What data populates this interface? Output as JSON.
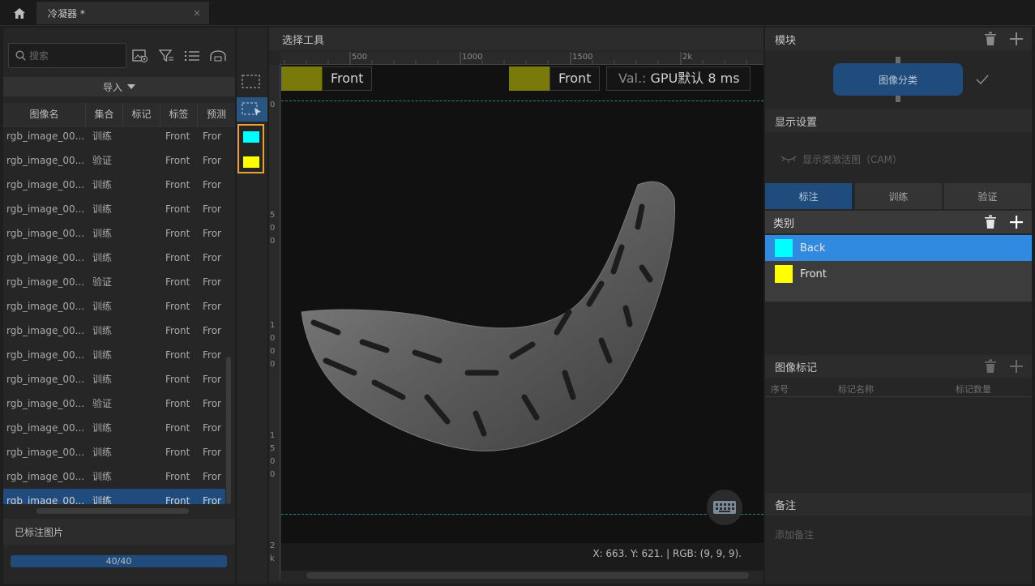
{
  "tab": {
    "title": "冷凝器 *",
    "close": "×"
  },
  "left": {
    "search_placeholder": "搜索",
    "import_label": "导入",
    "columns": [
      "图像名",
      "集合",
      "标记",
      "标签",
      "预测"
    ],
    "rows": [
      {
        "name": "rgb_image_00...",
        "set": "训练",
        "tag": "Front",
        "pred": "Fror"
      },
      {
        "name": "rgb_image_00...",
        "set": "验证",
        "tag": "Front",
        "pred": "Fror"
      },
      {
        "name": "rgb_image_00...",
        "set": "训练",
        "tag": "Front",
        "pred": "Fror"
      },
      {
        "name": "rgb_image_00...",
        "set": "训练",
        "tag": "Front",
        "pred": "Fror"
      },
      {
        "name": "rgb_image_00...",
        "set": "训练",
        "tag": "Front",
        "pred": "Fror"
      },
      {
        "name": "rgb_image_00...",
        "set": "训练",
        "tag": "Front",
        "pred": "Fror"
      },
      {
        "name": "rgb_image_00...",
        "set": "验证",
        "tag": "Front",
        "pred": "Fror"
      },
      {
        "name": "rgb_image_00...",
        "set": "训练",
        "tag": "Front",
        "pred": "Fror"
      },
      {
        "name": "rgb_image_00...",
        "set": "训练",
        "tag": "Front",
        "pred": "Fror"
      },
      {
        "name": "rgb_image_00...",
        "set": "训练",
        "tag": "Front",
        "pred": "Fror"
      },
      {
        "name": "rgb_image_00...",
        "set": "训练",
        "tag": "Front",
        "pred": "Fror"
      },
      {
        "name": "rgb_image_00...",
        "set": "验证",
        "tag": "Front",
        "pred": "Fror"
      },
      {
        "name": "rgb_image_00...",
        "set": "训练",
        "tag": "Front",
        "pred": "Fror"
      },
      {
        "name": "rgb_image_00...",
        "set": "训练",
        "tag": "Front",
        "pred": "Fror"
      },
      {
        "name": "rgb_image_00...",
        "set": "训练",
        "tag": "Front",
        "pred": "Fror"
      },
      {
        "name": "rgb_image_00...",
        "set": "训练",
        "tag": "Front",
        "pred": "Fror"
      }
    ],
    "selected_row": 15,
    "labeled_title": "已标注图片",
    "progress_text": "40/40",
    "progress_value": 1.0
  },
  "tools": {
    "swatch_colors": [
      "#00ffff",
      "#ffff00"
    ]
  },
  "canvas": {
    "title": "选择工具",
    "ruler_top": [
      "500",
      "1000",
      "1500",
      "2k"
    ],
    "ruler_left": [
      "0",
      "5",
      "0",
      "0",
      "1",
      "0",
      "0",
      "0",
      "1",
      "5",
      "0",
      "0",
      "2",
      "k"
    ],
    "label_left": "Front",
    "label_right": "Front",
    "val_key": "Val.:",
    "val_text": "GPU默认 8 ms",
    "coords": "X: 663. Y: 621. | RGB: (9, 9, 9)."
  },
  "right": {
    "module_title": "模块",
    "module_button": "图像分类",
    "display_title": "显示设置",
    "cam_label": "显示类激活图（CAM）",
    "tabs": [
      "标注",
      "训练",
      "验证"
    ],
    "active_tab": 0,
    "class_title": "类别",
    "classes": [
      {
        "name": "Back",
        "color": "#00ffff"
      },
      {
        "name": "Front",
        "color": "#ffff00"
      }
    ],
    "selected_class": 0,
    "marks_title": "图像标记",
    "marks_columns": [
      "序号",
      "标记名称",
      "标记数量"
    ],
    "notes_title": "备注",
    "notes_placeholder": "添加备注"
  }
}
